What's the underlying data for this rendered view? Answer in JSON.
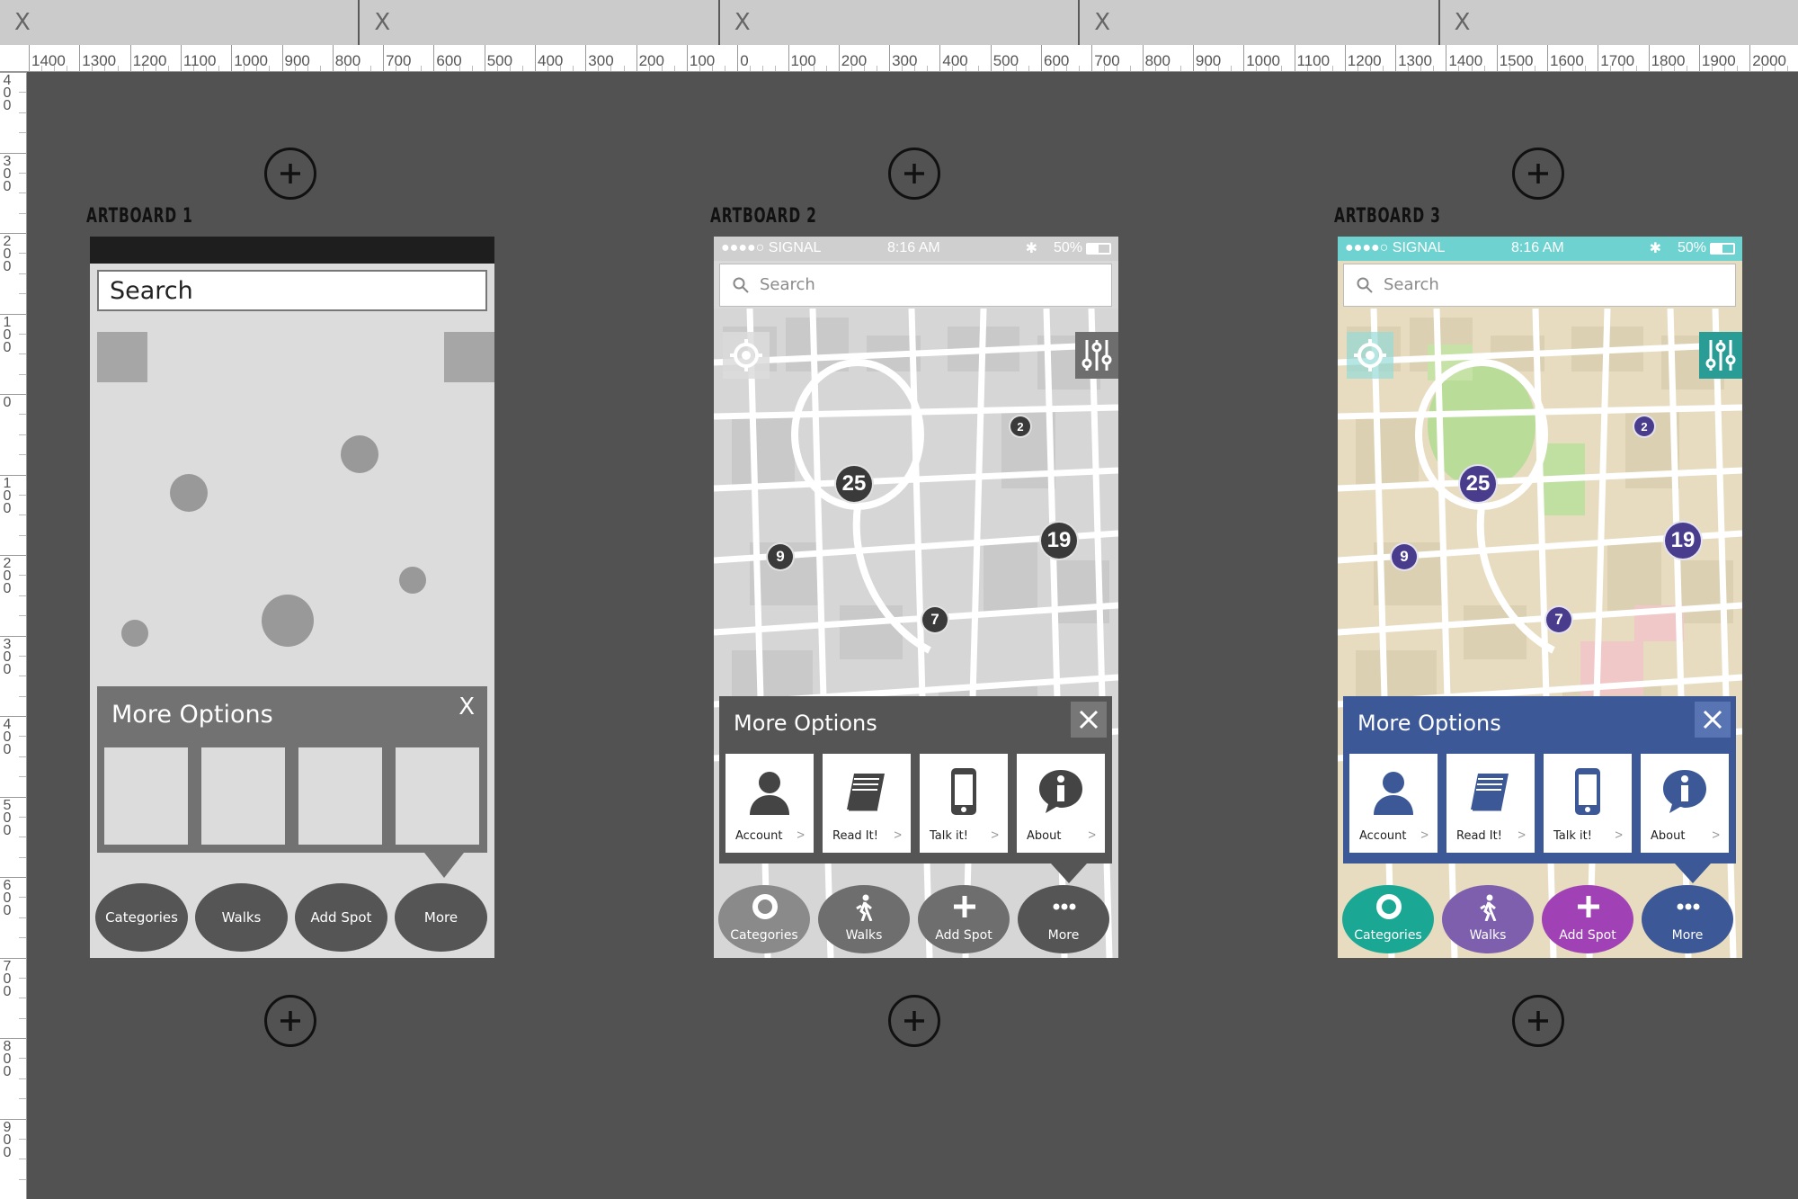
{
  "tabs": [
    "X",
    "X",
    "X",
    "X",
    "X"
  ],
  "ruler_h": [
    "1400",
    "1300",
    "1200",
    "1100",
    "1000",
    "900",
    "800",
    "700",
    "600",
    "500",
    "400",
    "300",
    "200",
    "100",
    "0",
    "100",
    "200",
    "300",
    "400",
    "500",
    "600",
    "700",
    "800",
    "900",
    "1000",
    "1100",
    "1200",
    "1300",
    "1400",
    "1500",
    "1600",
    "1700",
    "1800",
    "1900",
    "2000"
  ],
  "ruler_v": [
    "400",
    "300",
    "200",
    "100",
    "0",
    "100",
    "200",
    "300",
    "400",
    "500",
    "600",
    "700",
    "800",
    "900"
  ],
  "artboards": [
    {
      "label": "ARTBOARD 1"
    },
    {
      "label": "ARTBOARD 2"
    },
    {
      "label": "ARTBOARD 3"
    }
  ],
  "wireframe": {
    "search": "Search",
    "panel_title": "More Options",
    "panel_close": "X",
    "nav": [
      "Categories",
      "Walks",
      "Add Spot",
      "More"
    ]
  },
  "status": {
    "signal": "●●●●○ SIGNAL",
    "time": "8:16 AM",
    "battery": "50%"
  },
  "search_placeholder": "Search",
  "options_title": "More Options",
  "options": [
    "Account",
    "Read It!",
    "Talk it!",
    "About"
  ],
  "nav": [
    "Categories",
    "Walks",
    "Add Spot",
    "More"
  ],
  "pins": [
    "25",
    "2",
    "19",
    "9",
    "7"
  ],
  "colors": {
    "canvas": "#525252",
    "mono_status": "#cfcfcf",
    "mono_panel": "#555555",
    "mono_nav": "#6e6e6e",
    "color_status": "#6ed3d0",
    "color_panel": "#3c5896",
    "color_pin": "#4a3c8c",
    "nav_categories": "#1aa894",
    "nav_walks": "#7d5fad",
    "nav_add": "#a042b5",
    "nav_more": "#3c5896",
    "accent_teal": "#2a9c96"
  }
}
